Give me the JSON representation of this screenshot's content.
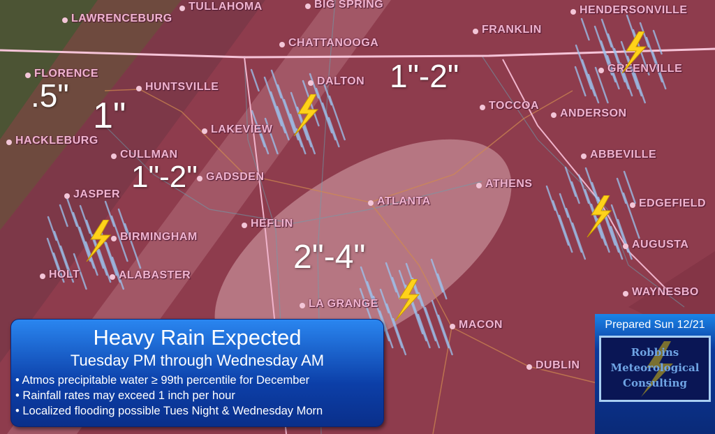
{
  "colors": {
    "heavy": "#8e3d4e",
    "light_band": "#c88a96",
    "green": "#4c5434",
    "info_box": "#1560d0",
    "bolt": "#ffd21a"
  },
  "cities": [
    "TULLAHOMA",
    "LAWRENCEBURG",
    "BIG SPRING",
    "HENDERSONVILLE",
    "FRANKLIN",
    "CHATTANOOGA",
    "FLORENCE",
    "HUNTSVILLE",
    "DALTON",
    "GREENVILLE",
    "TOCCOA",
    "ANDERSON",
    "HACKLEBURG",
    "LAKEVIEW",
    "CULLMAN",
    "ABBEVILLE",
    "GADSDEN",
    "JASPER",
    "ATHENS",
    "ATLANTA",
    "EDGEFIELD",
    "HEFLIN",
    "BIRMINGHAM",
    "AUGUSTA",
    "HOLT",
    "ALABASTER",
    "WAYNESBO",
    "LA GRANGE",
    "MACON",
    "DUBLIN"
  ],
  "totals": [
    ".5\"",
    "1\"",
    "1\"-2\"",
    "1\"-2\"",
    "2\"-4\""
  ],
  "info": {
    "title": "Heavy Rain Expected",
    "subtitle": "Tuesday PM through Wednesday AM",
    "bullets": [
      "• Atmos precipitable water ≥ 99th percentile for December",
      "• Rainfall rates may exceed 1 inch per hour",
      "• Localized flooding possible Tues Night & Wednesday Morn"
    ]
  },
  "brand": {
    "prepared": "Prepared Sun 12/21",
    "logo_lines": [
      "Robbins",
      "Meteorological",
      "Consulting"
    ]
  },
  "icons": [
    "lightning-bolt-icon",
    "rain-streaks-icon"
  ]
}
